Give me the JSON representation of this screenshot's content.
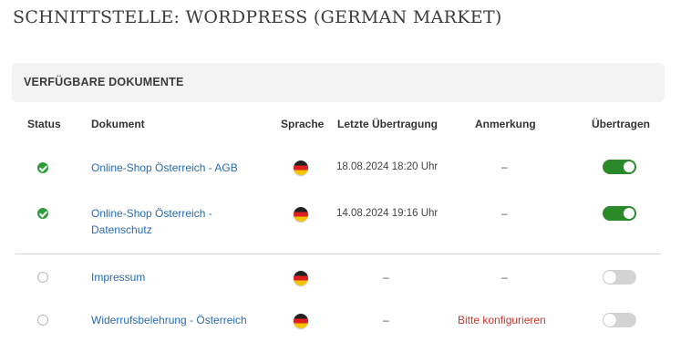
{
  "page": {
    "title": "SCHNITTSTELLE: WORDPRESS (GERMAN MARKET)"
  },
  "panel": {
    "title": "VERFÜGBARE DOKUMENTE"
  },
  "table": {
    "headers": {
      "status": "Status",
      "document": "Dokument",
      "language": "Sprache",
      "last_transfer": "Letzte Übertragung",
      "note": "Anmerkung",
      "transfer": "Übertragen"
    },
    "rows": [
      {
        "status": "ok",
        "document": "Online-Shop Österreich - AGB",
        "language": "german-flag-icon",
        "last_transfer": "18.08.2024 18:20 Uhr",
        "note": "–",
        "transfer": "on"
      },
      {
        "status": "ok",
        "document": "Online-Shop Österreich - Datenschutz",
        "language": "german-flag-icon",
        "last_transfer": "14.08.2024 19:16 Uhr",
        "note": "–",
        "transfer": "on"
      },
      {
        "status": "empty",
        "document": "Impressum",
        "language": "german-flag-icon",
        "last_transfer": "–",
        "note": "–",
        "transfer": "off"
      },
      {
        "status": "empty",
        "document": "Widerrufsbelehrung - Österreich",
        "language": "german-flag-icon",
        "last_transfer": "–",
        "note": "Bitte konfigurieren",
        "transfer": "off"
      }
    ]
  },
  "colors": {
    "link": "#2a6bb0",
    "status_ok": "#2e9d3a",
    "toggle_on": "#2a8a2a",
    "toggle_off": "#d3d3d3",
    "warning_text": "#c0392b",
    "panel_header_bg": "#f3f3f3"
  }
}
